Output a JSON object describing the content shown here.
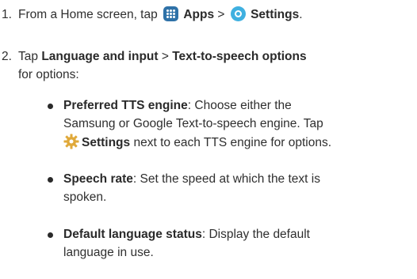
{
  "steps": [
    {
      "number": "1.",
      "text_a": "From a Home screen, tap ",
      "apps": "Apps",
      "sep": " > ",
      "settings": "Settings",
      "end": "."
    },
    {
      "number": "2.",
      "text_a": "Tap ",
      "lang": "Language and input",
      "sep": " > ",
      "tts": "Text-to-speech options",
      "line2": "for options:"
    }
  ],
  "bullets": [
    {
      "term": "Preferred TTS engine",
      "l1": ": Choose either the",
      "l2": "Samsung or Google Text-to-speech engine. Tap",
      "settings": "Settings",
      "l3": " next to each TTS engine for options."
    },
    {
      "term": "Speech rate",
      "l1": ": Set the speed at which the text is",
      "l2": "spoken."
    },
    {
      "term": "Default language status",
      "l1": ": Display the default",
      "l2": "language in use."
    }
  ],
  "icons": {
    "apps": "apps-grid-icon",
    "settings": "settings-icon",
    "gear": "gear-icon"
  },
  "colors": {
    "apps_icon": "#2f72a8",
    "settings_icon": "#3fb0e0",
    "gear_icon": "#e0a93a"
  }
}
